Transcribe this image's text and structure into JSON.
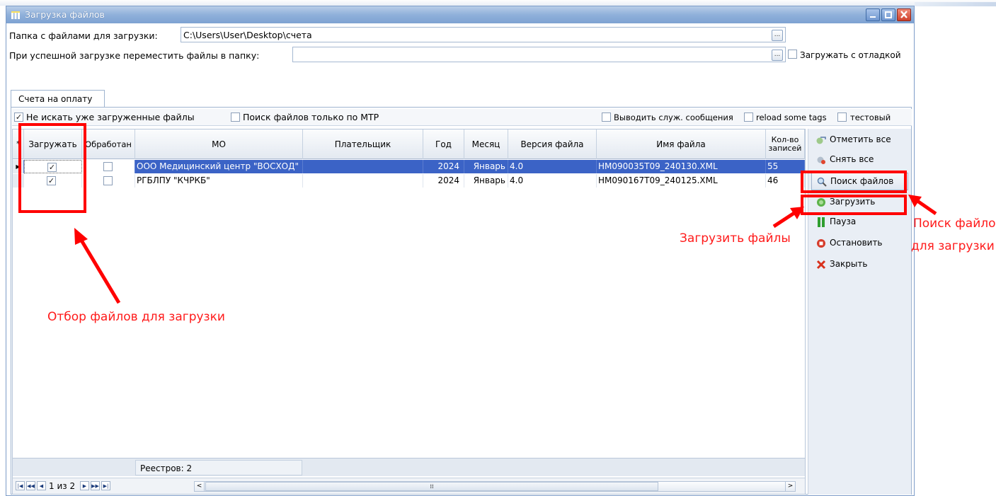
{
  "window": {
    "title": "Загрузка файлов"
  },
  "form": {
    "folder_label": "Папка с файлами для загрузки:",
    "folder_value": "C:\\Users\\User\\Desktop\\счета",
    "move_label": "При успешной загрузке переместить файлы в папку:",
    "move_value": "",
    "ellipsis": "...",
    "debug_label": "Загружать с отладкой",
    "debug_checked": false
  },
  "tabs": [
    {
      "label": "Счета на оплату",
      "active": true
    }
  ],
  "options": {
    "skip_loaded_label": "Не искать уже загруженные файлы",
    "skip_loaded_checked": true,
    "mtr_only_label": "Поиск файлов только по МТР",
    "mtr_only_checked": false,
    "service_msgs_label": "Выводить служ. сообщения",
    "service_msgs_checked": false,
    "reload_tags_label": "reload some tags",
    "reload_tags_checked": false,
    "test_label": "тестовый",
    "test_checked": false
  },
  "grid": {
    "columns": [
      "Загружать",
      "Обработан",
      "МО",
      "Плательщик",
      "Год",
      "Месяц",
      "Версия файла",
      "Имя файла",
      "Кол-во записей"
    ],
    "rows": [
      {
        "load": true,
        "processed": false,
        "mo": "ООО Медицинский центр \"ВОСХОД\"",
        "payer": "",
        "year": "2024",
        "month": "Январь",
        "version": "4.0",
        "filename": "HM090035T09_240130.XML",
        "count": "55",
        "selected": true
      },
      {
        "load": true,
        "processed": false,
        "mo": "РГБЛПУ \"КЧРКБ\"",
        "payer": "",
        "year": "2024",
        "month": "Январь",
        "version": "4.0",
        "filename": "HM090167T09_240125.XML",
        "count": "46",
        "selected": false
      }
    ],
    "footer": "Реестров: 2",
    "pager": "1 из 2"
  },
  "actions": [
    {
      "label": "Отметить все",
      "icon": "check-all-icon"
    },
    {
      "label": "Снять все",
      "icon": "uncheck-all-icon"
    },
    {
      "label": "Поиск файлов",
      "icon": "search-icon"
    },
    {
      "label": "Загрузить",
      "icon": "load-icon"
    },
    {
      "label": "Пауза",
      "icon": "pause-icon"
    },
    {
      "label": "Остановить",
      "icon": "stop-icon"
    },
    {
      "label": "Закрыть",
      "icon": "close-icon"
    }
  ],
  "annotations": {
    "select_files": "Отбор файлов для загрузки",
    "load_files": "Загрузить файлы",
    "search_line1": "Поиск файлов",
    "search_line2": "для загрузки",
    "color": "#ff0000"
  }
}
